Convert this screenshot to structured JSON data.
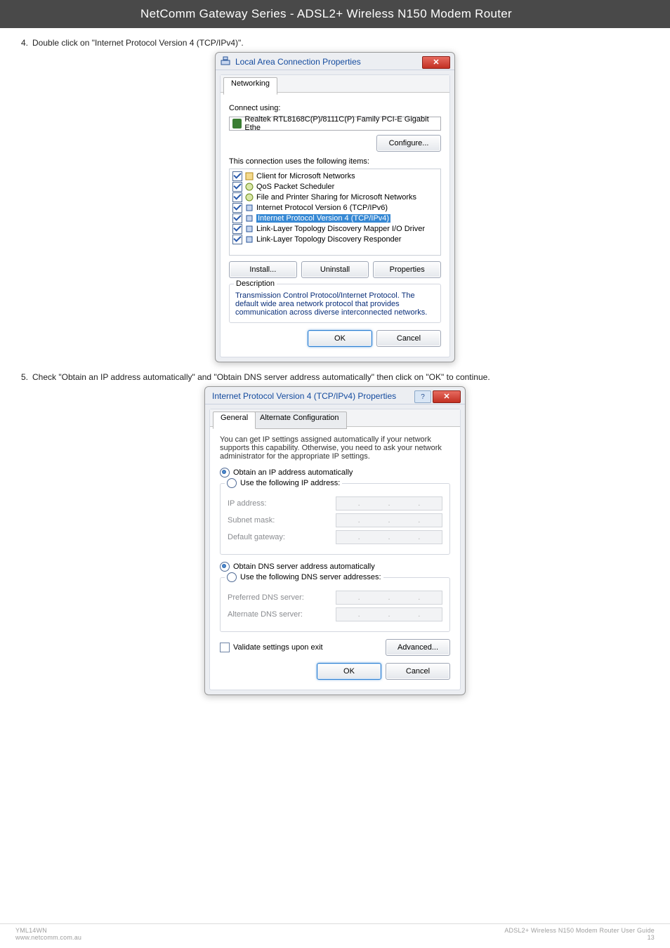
{
  "banner": "NetComm Gateway Series - ADSL2+ Wireless N150 Modem Router",
  "steps": {
    "s4": "Double click on \"Internet Protocol Version 4 (TCP/IPv4)\".",
    "s5": "Check \"Obtain an IP address automatically\" and \"Obtain DNS server address automatically\" then click on \"OK\" to continue."
  },
  "lac": {
    "title": "Local Area Connection Properties",
    "tab": "Networking",
    "connect_using": "Connect using:",
    "adapter": "Realtek RTL8168C(P)/8111C(P) Family PCI-E Gigabit Ethe",
    "configure_btn": "Configure...",
    "uses_items": "This connection uses the following items:",
    "items": [
      "Client for Microsoft Networks",
      "QoS Packet Scheduler",
      "File and Printer Sharing for Microsoft Networks",
      "Internet Protocol Version 6 (TCP/IPv6)",
      "Internet Protocol Version 4 (TCP/IPv4)",
      "Link-Layer Topology Discovery Mapper I/O Driver",
      "Link-Layer Topology Discovery Responder"
    ],
    "install": "Install...",
    "uninstall": "Uninstall",
    "properties": "Properties",
    "desc_label": "Description",
    "desc_text": "Transmission Control Protocol/Internet Protocol. The default wide area network protocol that provides communication across diverse interconnected networks.",
    "ok": "OK",
    "cancel": "Cancel"
  },
  "ip": {
    "title": "Internet Protocol Version 4 (TCP/IPv4) Properties",
    "tab_general": "General",
    "tab_alt": "Alternate Configuration",
    "help": "You can get IP settings assigned automatically if your network supports this capability. Otherwise, you need to ask your network administrator for the appropriate IP settings.",
    "auto_ip": "Obtain an IP address automatically",
    "use_ip": "Use the following IP address:",
    "ip_addr": "IP address:",
    "subnet": "Subnet mask:",
    "gateway": "Default gateway:",
    "auto_dns": "Obtain DNS server address automatically",
    "use_dns": "Use the following DNS server addresses:",
    "pref_dns": "Preferred DNS server:",
    "alt_dns": "Alternate DNS server:",
    "validate": "Validate settings upon exit",
    "advanced": "Advanced...",
    "ok": "OK",
    "cancel": "Cancel"
  },
  "footer": {
    "left1": "YML14WN",
    "left2": "www.netcomm.com.au",
    "right1": "ADSL2+ Wireless N150 Modem Router User Guide",
    "right2": "13"
  }
}
